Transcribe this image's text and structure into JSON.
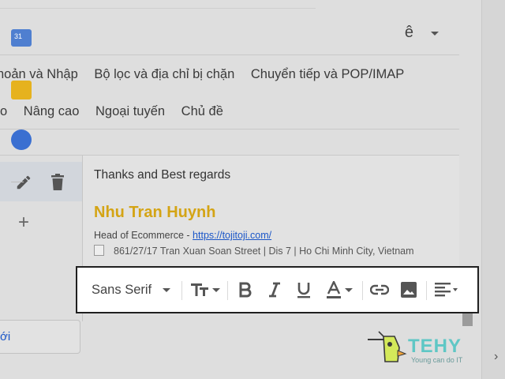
{
  "header": {
    "language_char": "ê"
  },
  "tabs_row1": [
    "hoản và Nhập",
    "Bộ lọc và địa chỉ bị chặn",
    "Chuyển tiếp và POP/IMAP"
  ],
  "tabs_row2": [
    "o",
    "Nâng cao",
    "Ngoại tuyến",
    "Chủ đề"
  ],
  "signature": {
    "regards": "Thanks and Best regards",
    "name": "Nhu Tran Huynh",
    "title": "Head of Ecommerce - ",
    "link": "https://tojitoji.com/",
    "address": "861/27/17 Tran Xuan Soan Street | Dis 7 | Ho Chi Minh City, Vietnam"
  },
  "toolbar": {
    "font": "Sans Serif",
    "icons": [
      "font-size-icon",
      "bold-icon",
      "italic-icon",
      "underline-icon",
      "text-color-icon",
      "link-icon",
      "image-icon",
      "align-icon"
    ]
  },
  "reply": {
    "label": "ới"
  },
  "sidebar": {
    "calendar_day": "31"
  },
  "logo": {
    "brand": "TEHY",
    "tagline": "Young can do IT"
  },
  "colors": {
    "signature_name": "#d4a415",
    "link": "#1a56c8",
    "logo": "#5fc7c5"
  }
}
